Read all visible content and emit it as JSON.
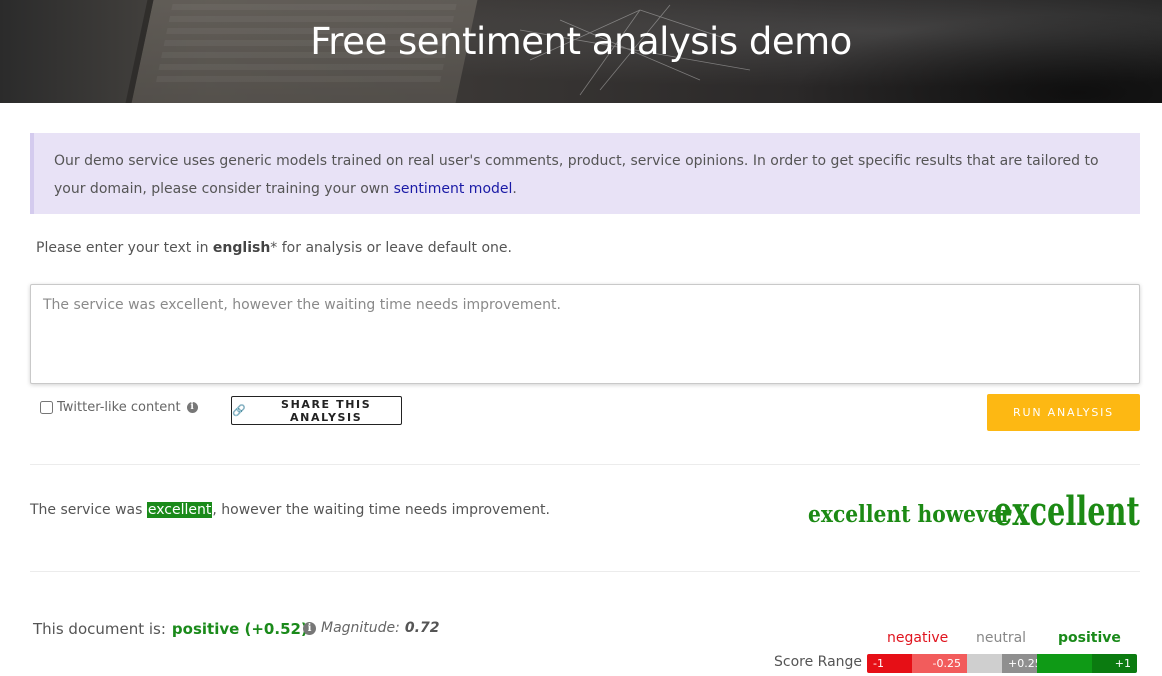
{
  "header": {
    "title": "Free sentiment analysis demo"
  },
  "notice": {
    "text": "Our demo service uses generic models trained on real user's comments, product, service opinions.  In order to get specific results that are tailored to your domain, please consider training your own ",
    "link": "sentiment model",
    "suffix": "."
  },
  "prompt": {
    "before": "Please enter your text in ",
    "language": "english",
    "after": "* for analysis or leave default one."
  },
  "input": {
    "value": "The service was excellent, however the waiting time needs improvement."
  },
  "controls": {
    "twitter_label": "Twitter-like content",
    "share_label": "SHARE THIS ANALYSIS",
    "run_label": "RUN ANALYSIS"
  },
  "result": {
    "before": "The service was ",
    "highlight": "excellent",
    "after": ", however the waiting time needs improvement."
  },
  "word_cloud": [
    "excellent however",
    "excellent"
  ],
  "summary": {
    "label": "This document is:",
    "score": "positive (+0.52)",
    "magnitude_label": "Magnitude:",
    "magnitude_value": "0.72"
  },
  "legend": {
    "negative": "negative",
    "neutral": "neutral",
    "positive": "positive"
  },
  "score_range": {
    "label": "Score Range",
    "ticks": [
      "-1",
      "-0.25",
      "+0.25",
      "+1"
    ]
  },
  "colors": {
    "accent": "#fdb813",
    "positive": "#1a8a1a",
    "negative": "#e0141e",
    "notice_bg": "#e8e2f6"
  }
}
